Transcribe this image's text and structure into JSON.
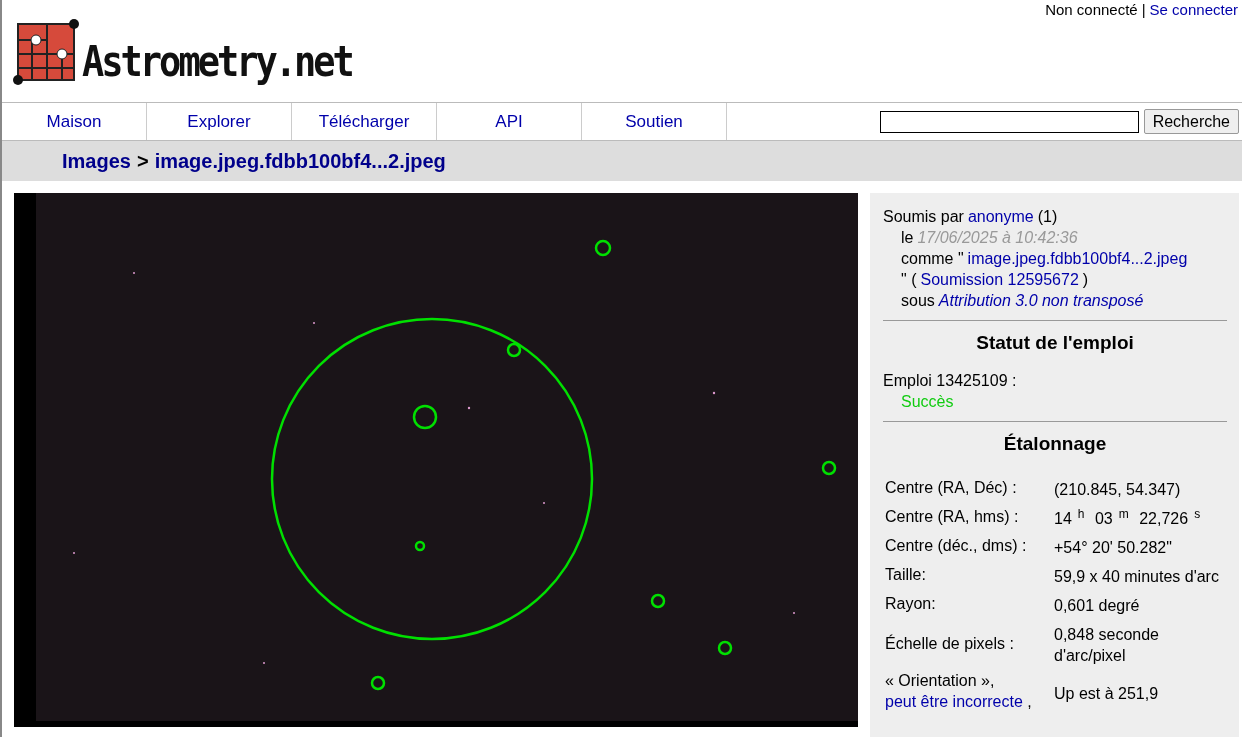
{
  "login": {
    "status": "Non connecté",
    "separator": "|",
    "link": "Se connecter"
  },
  "logo": {
    "text": "Astrometry.net"
  },
  "nav": {
    "items": [
      {
        "label": "Maison"
      },
      {
        "label": "Explorer"
      },
      {
        "label": "Télécharger"
      },
      {
        "label": "API"
      },
      {
        "label": "Soutien"
      }
    ],
    "search": {
      "button": "Recherche"
    }
  },
  "breadcrumb": [
    {
      "kind": "link",
      "text": "Images"
    },
    {
      "kind": "sep",
      "text": ">"
    },
    {
      "kind": "link",
      "text": "image.jpeg.fdbb100bf4...2.jpeg"
    }
  ],
  "submission": [
    [
      {
        "kind": "plain",
        "text": "Soumis par"
      },
      {
        "kind": "link",
        "text": "anonyme"
      },
      {
        "kind": "plain",
        "text": "(1)"
      }
    ],
    [
      {
        "kind": "plain",
        "text": "le"
      },
      {
        "kind": "date",
        "text": "17/06/2025 à 10:42:36"
      }
    ],
    [
      {
        "kind": "plain",
        "text": "comme \""
      },
      {
        "kind": "link",
        "text": "image.jpeg.fdbb100bf4...2.jpeg"
      }
    ],
    [
      {
        "kind": "plain",
        "text": "\" ("
      },
      {
        "kind": "link",
        "text": "Soumission 12595672"
      },
      {
        "kind": "plain",
        "text": ")"
      }
    ],
    [
      {
        "kind": "plain",
        "text": "sous"
      },
      {
        "kind": "license",
        "text": "Attribution 3.0 non transposé"
      }
    ]
  ],
  "job_status": {
    "title": "Statut de l'emploi",
    "job": "Emploi 13425109 :",
    "result": "Succès",
    "succeeded": true
  },
  "calibration": {
    "title": "Étalonnage",
    "rows": [
      {
        "label": [
          {
            "kind": "plain",
            "text": "Centre (RA, Déc) :"
          }
        ],
        "value": "(210.845, 54.347)"
      },
      {
        "label": [
          {
            "kind": "plain",
            "text": "Centre (RA, hms) :"
          }
        ],
        "value": "14$^{h}$ 03$^{m}$ 22,726$^{s}$"
      },
      {
        "label": [
          {
            "kind": "plain",
            "text": "Centre (déc., dms) :"
          }
        ],
        "value": "+54° 20' 50.282\""
      },
      {
        "label": [
          {
            "kind": "plain",
            "text": "Taille:"
          }
        ],
        "value": "59,9 x 40 minutes d'arc"
      },
      {
        "label": [
          {
            "kind": "plain",
            "text": "Rayon:"
          }
        ],
        "value": "0,601 degré"
      },
      {
        "label": [
          {
            "kind": "plain",
            "text": "Échelle de pixels :"
          }
        ],
        "value": "0,848 seconde d'arc/pixel"
      },
      {
        "label": [
          {
            "kind": "plain",
            "text": "« Orientation »,"
          },
          {
            "kind": "link",
            "text": "peut être incorrecte"
          },
          {
            "kind": "plain",
            "text": ","
          }
        ],
        "value": "Up est à 251,9"
      }
    ]
  }
}
